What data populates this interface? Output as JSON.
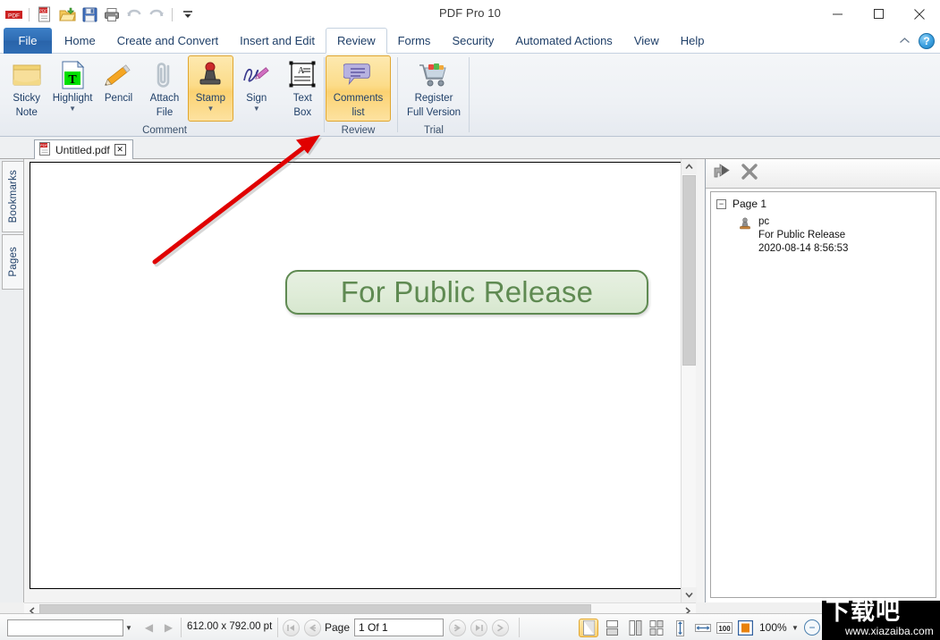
{
  "window": {
    "title": "PDF Pro 10",
    "minimize_label": "—",
    "maximize_label": "☐",
    "close_label": "✕"
  },
  "quick_access": {
    "items": [
      {
        "name": "pdf-logo-icon",
        "label": "PDF"
      },
      {
        "name": "new-pdf-icon",
        "label": "New"
      },
      {
        "name": "open-folder-icon",
        "label": "Open"
      },
      {
        "name": "save-icon",
        "label": "Save"
      },
      {
        "name": "print-icon",
        "label": "Print"
      },
      {
        "name": "undo-icon",
        "label": "Undo"
      },
      {
        "name": "redo-icon",
        "label": "Redo"
      },
      {
        "name": "customize-qat-icon",
        "label": "Customize Quick Access Toolbar"
      }
    ]
  },
  "ribbon_tabs": {
    "file_label": "File",
    "items": [
      {
        "label": "Home",
        "active": false
      },
      {
        "label": "Create and Convert",
        "active": false
      },
      {
        "label": "Insert and Edit",
        "active": false
      },
      {
        "label": "Review",
        "active": true
      },
      {
        "label": "Forms",
        "active": false
      },
      {
        "label": "Security",
        "active": false
      },
      {
        "label": "Automated Actions",
        "active": false
      },
      {
        "label": "View",
        "active": false
      },
      {
        "label": "Help",
        "active": false
      }
    ],
    "collapse_icon": "chevron-up-icon",
    "help_icon_label": "?"
  },
  "ribbon": {
    "groups": [
      {
        "name": "comment",
        "label": "Comment",
        "buttons": [
          {
            "label": "Sticky\nNote",
            "line1": "Sticky",
            "line2": "Note",
            "icon": "sticky-note-icon",
            "selected": false,
            "caret": false
          },
          {
            "label": "Highlight",
            "line1": "Highlight",
            "line2": "",
            "icon": "highlight-icon",
            "selected": false,
            "caret": true
          },
          {
            "label": "Pencil",
            "line1": "Pencil",
            "line2": "",
            "icon": "pencil-icon",
            "selected": false,
            "caret": false
          },
          {
            "label": "Attach File",
            "line1": "Attach",
            "line2": "File",
            "icon": "paperclip-icon",
            "selected": false,
            "caret": false
          },
          {
            "label": "Stamp",
            "line1": "Stamp",
            "line2": "",
            "icon": "stamp-icon",
            "selected": true,
            "caret": true
          },
          {
            "label": "Sign",
            "line1": "Sign",
            "line2": "",
            "icon": "signature-icon",
            "selected": false,
            "caret": true
          },
          {
            "label": "Text Box",
            "line1": "Text",
            "line2": "Box",
            "icon": "text-box-icon",
            "selected": false,
            "caret": false
          }
        ]
      },
      {
        "name": "review",
        "label": "Review",
        "buttons": [
          {
            "label": "Comments list",
            "line1": "Comments",
            "line2": "list",
            "icon": "comments-list-icon",
            "selected": true,
            "caret": false
          }
        ]
      },
      {
        "name": "trial",
        "label": "Trial",
        "buttons": [
          {
            "label": "Register Full Version",
            "line1": "Register",
            "line2": "Full Version",
            "icon": "shopping-cart-icon",
            "selected": false,
            "caret": false
          }
        ]
      }
    ]
  },
  "document_tab": {
    "icon": "pdf-file-icon",
    "title": "Untitled.pdf",
    "close_label": "✕"
  },
  "side_tabs": [
    {
      "label": "Bookmarks",
      "name": "sidebar-tab-bookmarks"
    },
    {
      "label": "Pages",
      "name": "sidebar-tab-pages"
    }
  ],
  "page": {
    "stamp_text": "For Public Release",
    "stamp_color": "#5f8a52",
    "stamp_fill": "#e0ecd9"
  },
  "comments_panel": {
    "toolbar": [
      {
        "name": "reply-comment-button",
        "icon": "reply-arrow-icon",
        "label": "Reply"
      },
      {
        "name": "delete-comment-button",
        "icon": "delete-x-icon",
        "label": "Delete"
      }
    ],
    "tree": {
      "expander": "−",
      "page_label": "Page 1",
      "comment": {
        "icon": "stamp-comment-icon",
        "author": "pc",
        "text": "For Public Release",
        "timestamp": "2020-08-14 8:56:53"
      }
    }
  },
  "status_bar": {
    "search_value": "",
    "search_placeholder": "",
    "dropdown_icon": "chevron-down-icon",
    "prev_match_icon": "triangle-left-icon",
    "next_match_icon": "triangle-right-icon",
    "page_size": "612.00 x 792.00 pt",
    "first_page_icon": "first-page-icon",
    "prev_page_icon": "prev-page-icon",
    "page_label": "Page",
    "page_value": "1 Of 1",
    "next_page_icon": "next-page-icon",
    "last_page_icon": "last-page-icon",
    "view_modes": [
      {
        "name": "single-page-view-icon",
        "selected": true
      },
      {
        "name": "continuous-view-icon",
        "selected": false
      },
      {
        "name": "two-page-view-icon",
        "selected": false
      },
      {
        "name": "two-page-continuous-view-icon",
        "selected": false
      }
    ],
    "fit_modes": [
      {
        "name": "fit-height-icon"
      },
      {
        "name": "fit-width-icon"
      },
      {
        "name": "actual-size-icon"
      },
      {
        "name": "fit-page-icon"
      }
    ],
    "zoom_value": "100%",
    "zoom_dropdown_icon": "chevron-down-icon",
    "zoom_out_icon": "zoom-out-icon"
  },
  "watermark": {
    "text_cn": "下载吧",
    "url": "www.xiazaiba.com"
  },
  "annotation": {
    "arrow_color": "#e00000",
    "name": "red-arrow-pointing-to-comments-list"
  }
}
